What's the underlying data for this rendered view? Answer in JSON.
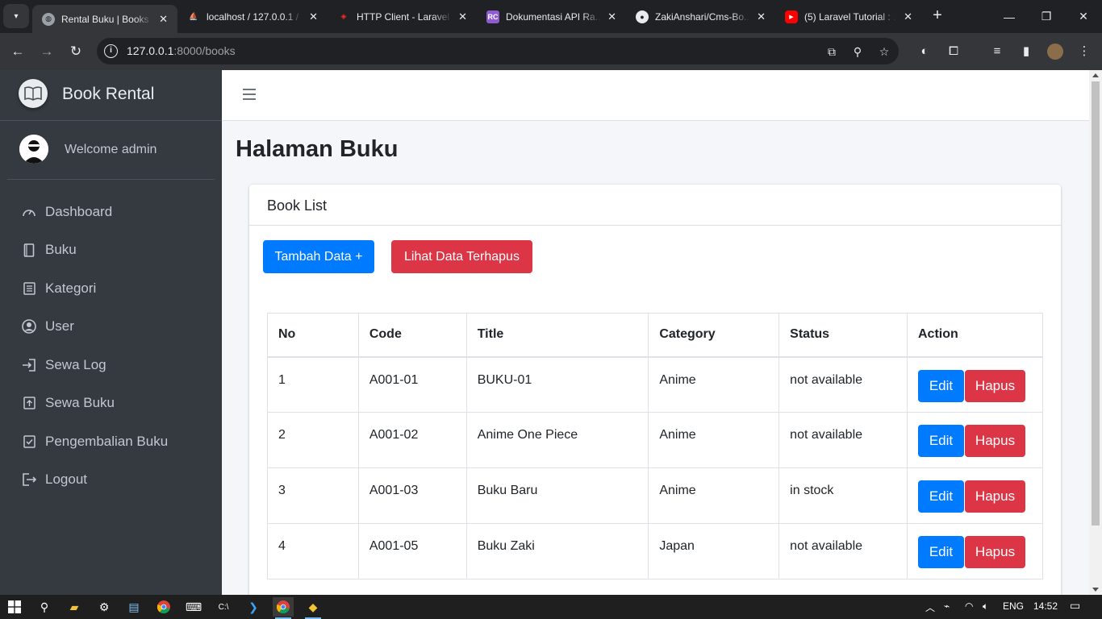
{
  "browser": {
    "tabs": [
      {
        "title": "Rental Buku | Books",
        "active": true,
        "favicon": "globe-icon"
      },
      {
        "title": "localhost / 127.0.0.1 / ...",
        "active": false,
        "favicon": "phpmyadmin-icon"
      },
      {
        "title": "HTTP Client - Laravel ...",
        "active": false,
        "favicon": "laravel-icon"
      },
      {
        "title": "Dokumentasi API Ra...",
        "active": false,
        "favicon": "rc-icon"
      },
      {
        "title": "ZakiAnshari/Cms-Bo...",
        "active": false,
        "favicon": "github-icon"
      },
      {
        "title": "(5) Laravel Tutorial : ...",
        "active": false,
        "favicon": "youtube-icon"
      }
    ],
    "url_host": "127.0.0.1",
    "url_path": ":8000/books"
  },
  "app": {
    "brand": "Book Rental",
    "welcome": "Welcome admin",
    "menu": [
      {
        "label": "Dashboard",
        "icon": "gauge-icon"
      },
      {
        "label": "Buku",
        "icon": "book-icon"
      },
      {
        "label": "Kategori",
        "icon": "list-icon"
      },
      {
        "label": "User",
        "icon": "user-circle-icon"
      },
      {
        "label": "Sewa Log",
        "icon": "sign-in-icon"
      },
      {
        "label": "Sewa Buku",
        "icon": "upload-icon"
      },
      {
        "label": "Pengembalian Buku",
        "icon": "check-square-icon"
      },
      {
        "label": "Logout",
        "icon": "sign-out-icon"
      }
    ]
  },
  "page": {
    "title": "Halaman Buku",
    "card_title": "Book List",
    "add_button": "Tambah Data +",
    "deleted_button": "Lihat Data Terhapus",
    "table": {
      "headers": [
        "No",
        "Code",
        "Title",
        "Category",
        "Status",
        "Action"
      ],
      "rows": [
        {
          "no": "1",
          "code": "A001-01",
          "title": "BUKU-01",
          "category": "Anime",
          "status": "not available"
        },
        {
          "no": "2",
          "code": "A001-02",
          "title": "Anime One Piece",
          "category": "Anime",
          "status": "not available"
        },
        {
          "no": "3",
          "code": "A001-03",
          "title": "Buku Baru",
          "category": "Anime",
          "status": "in stock"
        },
        {
          "no": "4",
          "code": "A001-05",
          "title": "Buku Zaki",
          "category": "Japan",
          "status": "not available"
        }
      ],
      "edit_label": "Edit",
      "delete_label": "Hapus"
    }
  },
  "taskbar": {
    "language": "ENG",
    "time": "14:52"
  },
  "colors": {
    "sidebar": "#343a40",
    "primary": "#007bff",
    "danger": "#dc3545",
    "content_bg": "#f4f6f9"
  }
}
